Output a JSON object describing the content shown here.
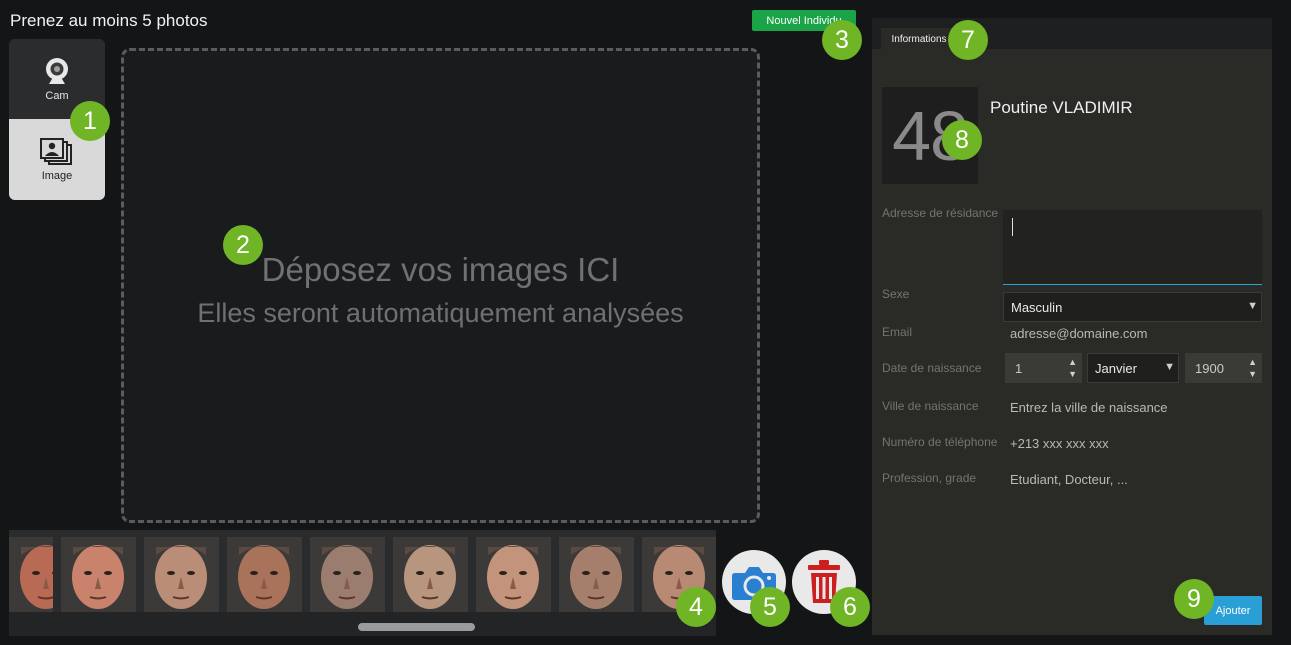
{
  "page": {
    "title": "Prenez au moins 5 photos"
  },
  "sources": {
    "cam": {
      "label": "Cam",
      "icon": "webcam-icon"
    },
    "image": {
      "label": "Image",
      "icon": "image-gallery-icon"
    }
  },
  "dropzone": {
    "title": "Déposez vos images ICI",
    "subtitle": "Elles seront automatiquement analysées"
  },
  "new_button": {
    "label": "Nouvel Individu"
  },
  "thumbnails": [
    {
      "icon": "face-photo",
      "tone": "#b86a55"
    },
    {
      "icon": "face-photo",
      "tone": "#c9826c"
    },
    {
      "icon": "face-photo",
      "tone": "#b98d76"
    },
    {
      "icon": "face-photo",
      "tone": "#a8735a"
    },
    {
      "icon": "face-photo",
      "tone": "#9a7d6e"
    },
    {
      "icon": "face-photo",
      "tone": "#b7957f"
    },
    {
      "icon": "face-photo",
      "tone": "#c4937c"
    },
    {
      "icon": "face-photo",
      "tone": "#a57f6c"
    },
    {
      "icon": "face-photo",
      "tone": "#b88a74"
    }
  ],
  "actions": {
    "capture": {
      "icon": "camera-icon",
      "color": "#2b7fd0"
    },
    "delete": {
      "icon": "trash-icon",
      "color": "#cc1f1f"
    }
  },
  "badges": [
    "1",
    "2",
    "3",
    "4",
    "5",
    "6",
    "7",
    "8",
    "9"
  ],
  "info_panel": {
    "tab_label": "Informations",
    "person_number": "48",
    "person_name": "Poutine VLADIMIR",
    "fields": {
      "address": {
        "label": "Adresse de résidance",
        "value": ""
      },
      "sex": {
        "label": "Sexe",
        "value": "Masculin"
      },
      "email": {
        "label": "Email",
        "placeholder": "adresse@domaine.com"
      },
      "birth_date": {
        "label": "Date de naissance",
        "day": "1",
        "month": "Janvier",
        "year": "1900"
      },
      "birth_city": {
        "label": "Ville de naissance",
        "placeholder": "Entrez la ville de naissance"
      },
      "phone": {
        "label": "Numéro de téléphone",
        "placeholder": "+213 xxx xxx xxx"
      },
      "profession": {
        "label": "Profession, grade",
        "placeholder": "Etudiant, Docteur, ..."
      }
    },
    "add_button": {
      "label": "Ajouter"
    }
  },
  "colors": {
    "accent_green": "#1aa347",
    "badge_green": "#6fb526",
    "accent_blue": "#2a9fd6"
  }
}
